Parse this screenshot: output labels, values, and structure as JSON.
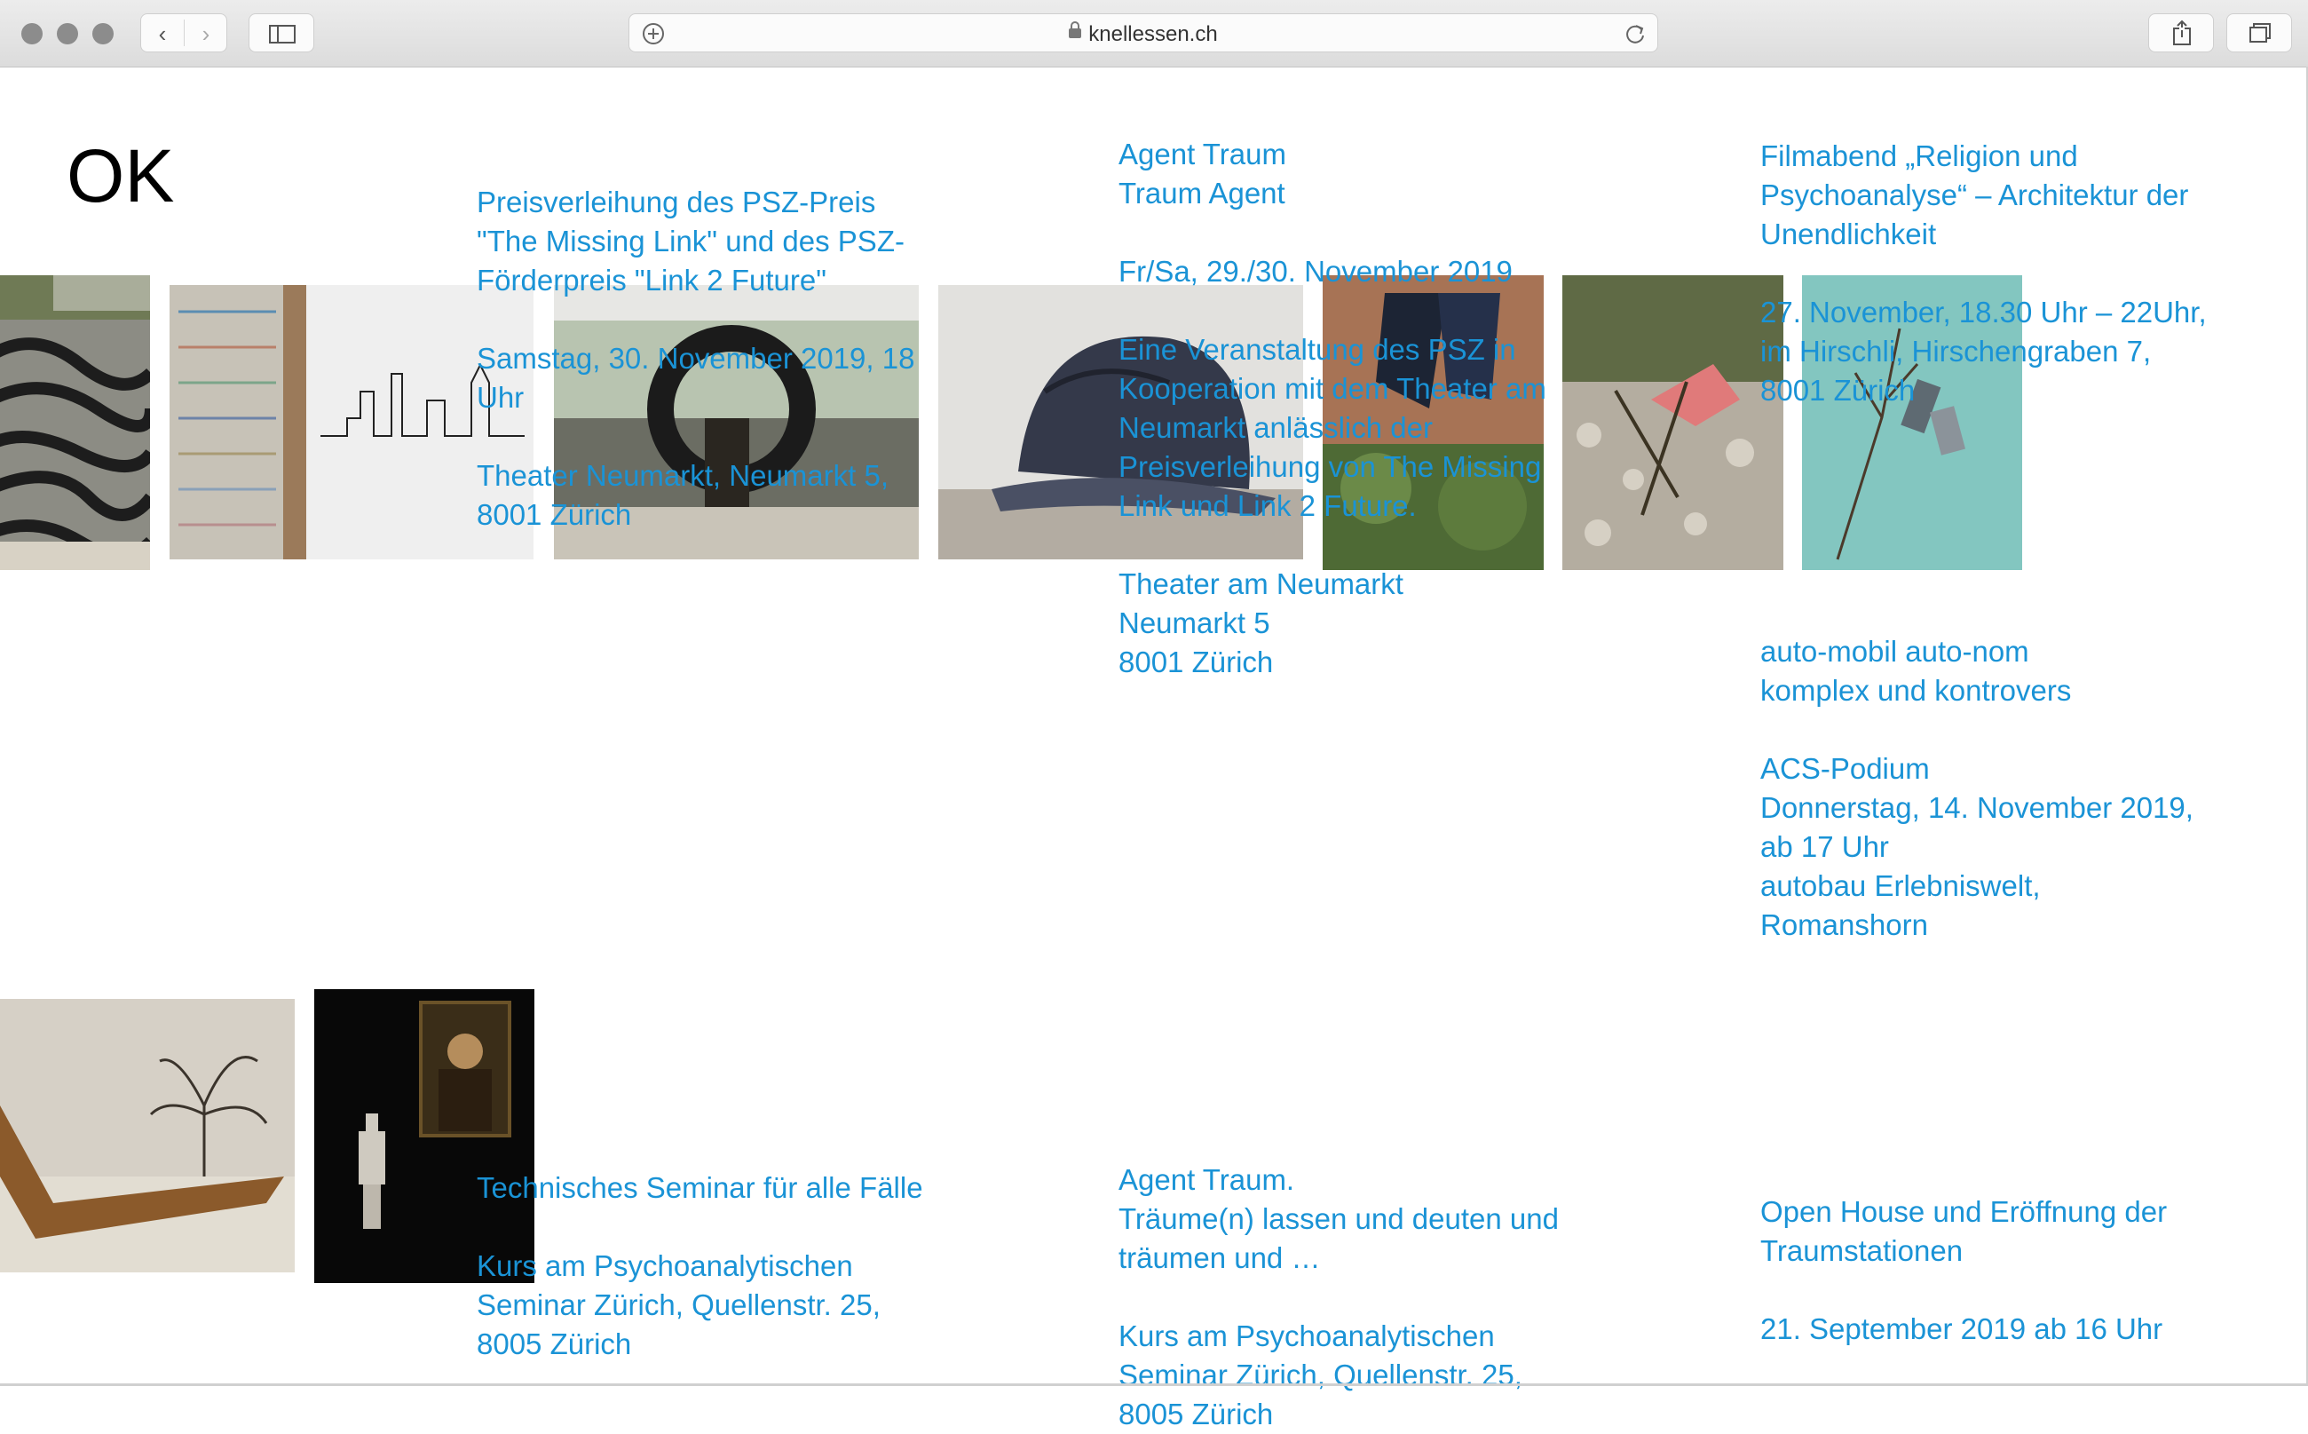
{
  "browser": {
    "url": "knellessen.ch",
    "back_icon": "chevron-left",
    "forward_icon": "chevron-right",
    "sidebar_icon": "sidebar",
    "add_icon": "plus-circle",
    "reload_icon": "reload",
    "share_icon": "share",
    "tabs_icon": "tabs"
  },
  "site": {
    "logo": "OK"
  },
  "events": [
    {
      "title": "Preisverleihung des PSZ-Preis \"The Missing Link\" und des PSZ-Förderpreis \"Link 2 Future\"",
      "date": "Samstag, 30. November 2019, 18 Uhr",
      "place": "Theater Neumarkt, Neumarkt 5, 8001 Zürich"
    },
    {
      "title": "Agent Traum\nTraum Agent",
      "date": "Fr/Sa, 29./30. November 2019",
      "description": "Eine Veranstaltung des PSZ in Kooperation mit dem Theater am Neumarkt anlässlich der Preisverleihung von The Missing Link und Link 2 Future.",
      "place": "Theater am Neumarkt\nNeumarkt 5\n8001 Zürich"
    },
    {
      "title": "Filmabend „Religion und Psychoanalyse“ – Architektur der Unendlichkeit",
      "date": "27. November, 18.30 Uhr – 22Uhr, im Hirschli, Hirschengraben 7, 8001 Zürich"
    },
    {
      "title": "auto-mobil auto-nom\nkomplex und kontrovers",
      "date": "ACS-Podium\nDonnerstag, 14. November 2019, ab 17 Uhr\nautobau Erlebniswelt, Romanshorn"
    },
    {
      "title": "Technisches Seminar für alle Fälle",
      "place": "Kurs am Psychoanalytischen Seminar Zürich, Quellenstr. 25, 8005 Zürich"
    },
    {
      "title": "Agent Traum.\nTräume(n) lassen und deuten und träumen und …",
      "place": "Kurs am Psychoanalytischen Seminar Zürich, Quellenstr. 25, 8005 Zürich"
    },
    {
      "title": "Open House und Eröffnung der Traumstationen",
      "date": "21. September 2019 ab 16 Uhr"
    }
  ]
}
